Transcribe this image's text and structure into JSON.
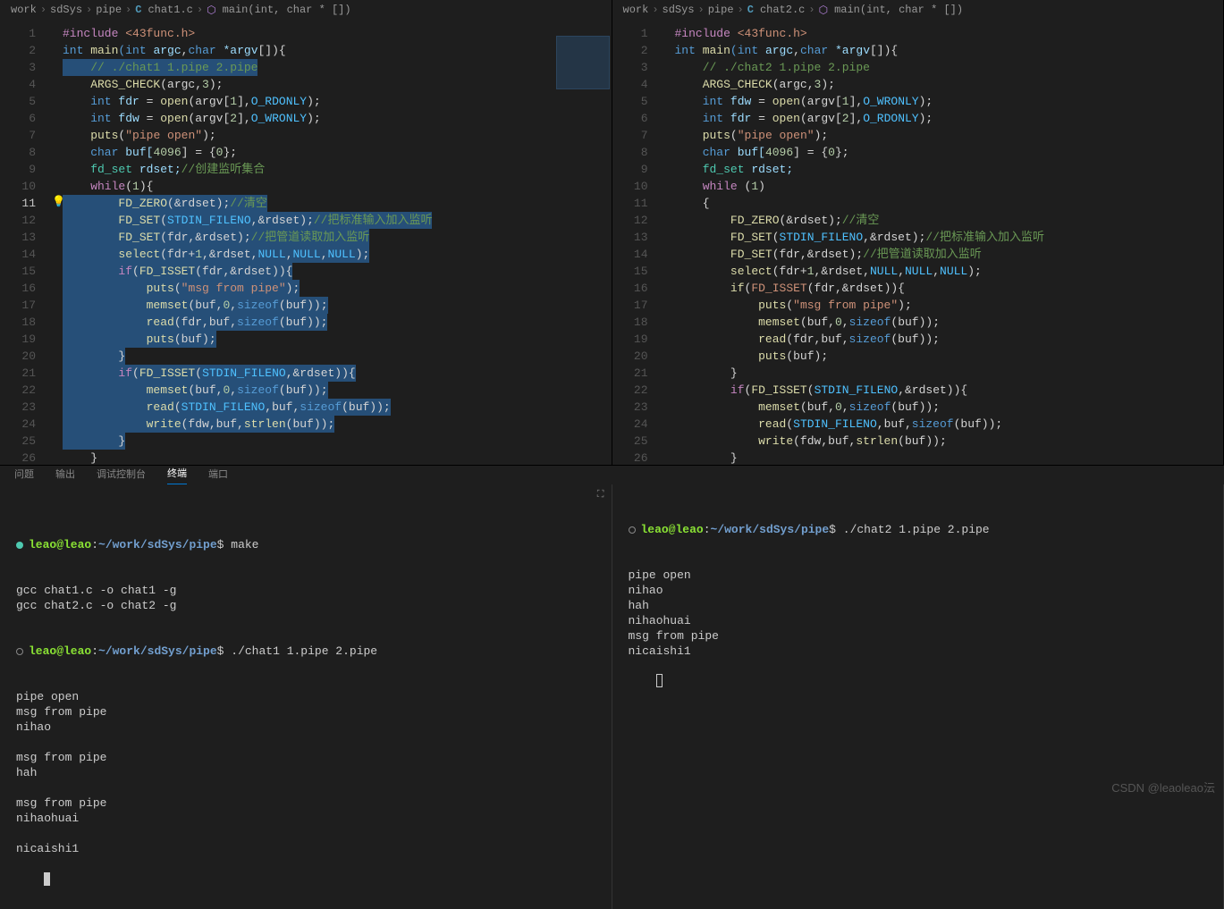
{
  "watermark": "CSDN @leaoleao沄",
  "panelTabs": {
    "problems": "问题",
    "output": "输出",
    "debugConsole": "调试控制台",
    "terminal": "终端",
    "ports": "端口"
  },
  "left": {
    "breadcrumb": {
      "p1": "work",
      "p2": "sdSys",
      "p3": "pipe",
      "file": "chat1.c",
      "fn": "main(int, char * [])"
    },
    "lines": [
      1,
      2,
      3,
      4,
      5,
      6,
      7,
      8,
      9,
      10,
      11,
      12,
      13,
      14,
      15,
      16,
      17,
      18,
      19,
      20,
      21,
      22,
      23,
      24,
      25,
      26
    ],
    "code": {
      "l1": {
        "a": "#include",
        "b": " <43func.h>"
      },
      "l2": {
        "a": "int",
        "b": " main",
        "c": "(int",
        "d": " argc",
        ",": ",",
        "e": "char",
        "f": " *argv",
        "g": "[]){"
      },
      "l3": "    // ./chat1 1.pipe 2.pipe",
      "l4": {
        "a": "    ARGS_CHECK",
        "b": "(argc,",
        "c": "3",
        "d": ");"
      },
      "l5": {
        "a": "    int",
        "b": " fdr ",
        "c": "=",
        "d": " open",
        "e": "(argv[",
        "f": "1",
        "g": "],",
        "h": "O_RDONLY",
        "i": ");"
      },
      "l6": {
        "a": "    int",
        "b": " fdw ",
        "c": "=",
        "d": " open",
        "e": "(argv[",
        "f": "2",
        "g": "],",
        "h": "O_WRONLY",
        "i": ");"
      },
      "l7": {
        "a": "    puts",
        "b": "(",
        "c": "\"pipe open\"",
        "d": ");"
      },
      "l8": {
        "a": "    char",
        "b": " buf[",
        "c": "4096",
        "d": "] = {",
        "e": "0",
        "f": "};"
      },
      "l9": {
        "a": "    fd_set",
        "b": " rdset;",
        "c": "//创建监听集合"
      },
      "l10": {
        "a": "    while",
        "b": "(",
        "c": "1",
        "d": "){"
      },
      "l11": {
        "a": "        FD_ZERO",
        "b": "(&rdset);",
        "c": "//清空"
      },
      "l12": {
        "a": "        FD_SET",
        "b": "(",
        "c": "STDIN_FILENO",
        "d": ",&rdset);",
        "e": "//把标准输入加入监听"
      },
      "l13": {
        "a": "        FD_SET",
        "b": "(fdr,&rdset);",
        "c": "//把管道读取加入监听"
      },
      "l14": {
        "a": "        select",
        "b": "(fdr+",
        "c": "1",
        "d": ",&rdset,",
        "e": "NULL",
        "f": ",",
        "g": "NULL",
        "h": ",",
        "i": "NULL",
        "j": ");"
      },
      "l15": {
        "a": "        if",
        "b": "(",
        "c": "FD_ISSET",
        "d": "(fdr,&rdset)){"
      },
      "l16": {
        "a": "            puts",
        "b": "(",
        "c": "\"msg from pipe\"",
        "d": ");"
      },
      "l17": {
        "a": "            memset",
        "b": "(buf,",
        "c": "0",
        "d": ",",
        "e": "sizeof",
        "f": "(buf));"
      },
      "l18": {
        "a": "            read",
        "b": "(fdr,buf,",
        "c": "sizeof",
        "d": "(buf));"
      },
      "l19": {
        "a": "            puts",
        "b": "(buf);"
      },
      "l20": "        }",
      "l21": {
        "a": "        if",
        "b": "(",
        "c": "FD_ISSET",
        "d": "(",
        "e": "STDIN_FILENO",
        "f": ",&rdset)){"
      },
      "l22": {
        "a": "            memset",
        "b": "(buf,",
        "c": "0",
        "d": ",",
        "e": "sizeof",
        "f": "(buf));"
      },
      "l23": {
        "a": "            read",
        "b": "(",
        "c": "STDIN_FILENO",
        "d": ",buf,",
        "e": "sizeof",
        "f": "(buf));"
      },
      "l24": {
        "a": "            write",
        "b": "(fdw,buf,",
        "c": "strlen",
        "d": "(buf));"
      },
      "l25": "        }",
      "l26": "    }"
    }
  },
  "right": {
    "breadcrumb": {
      "p1": "work",
      "p2": "sdSys",
      "p3": "pipe",
      "file": "chat2.c",
      "fn": "main(int, char * [])"
    },
    "lines": [
      1,
      2,
      3,
      4,
      5,
      6,
      7,
      8,
      9,
      10,
      11,
      12,
      13,
      14,
      15,
      16,
      17,
      18,
      19,
      20,
      21,
      22,
      23,
      24,
      25,
      26
    ],
    "code": {
      "l1": {
        "a": "#include",
        "b": " <43func.h>"
      },
      "l2": {
        "a": "int",
        "b": " main",
        "c": "(int",
        "d": " argc",
        ",": ",",
        "e": "char",
        "f": " *argv",
        "g": "[]){"
      },
      "l3": "    // ./chat2 1.pipe 2.pipe",
      "l4": {
        "a": "    ARGS_CHECK",
        "b": "(argc,",
        "c": "3",
        "d": ");"
      },
      "l5": {
        "a": "    int",
        "b": " fdw ",
        "c": "=",
        "d": " open",
        "e": "(argv[",
        "f": "1",
        "g": "],",
        "h": "O_WRONLY",
        "i": ");"
      },
      "l6": {
        "a": "    int",
        "b": " fdr ",
        "c": "=",
        "d": " open",
        "e": "(argv[",
        "f": "2",
        "g": "],",
        "h": "O_RDONLY",
        "i": ");"
      },
      "l7": {
        "a": "    puts",
        "b": "(",
        "c": "\"pipe open\"",
        "d": ");"
      },
      "l8": {
        "a": "    char",
        "b": " buf[",
        "c": "4096",
        "d": "] = {",
        "e": "0",
        "f": "};"
      },
      "l9": {
        "a": "    fd_set",
        "b": " rdset;"
      },
      "l10": {
        "a": "    while ",
        "b": "(",
        "c": "1",
        "d": ")"
      },
      "l11": "    {",
      "l12": {
        "a": "        FD_ZERO",
        "b": "(&rdset);",
        "c": "//清空"
      },
      "l13": {
        "a": "        FD_SET",
        "b": "(",
        "c": "STDIN_FILENO",
        "d": ",&rdset);",
        "e": "//把标准输入加入监听"
      },
      "l14": {
        "a": "        FD_SET",
        "b": "(fdr,&rdset);",
        "c": "//把管道读取加入监听"
      },
      "l15": {
        "a": "        select",
        "b": "(fdr+",
        "c": "1",
        "d": ",&rdset,",
        "e": "NULL",
        "f": ",",
        "g": "NULL",
        "h": ",",
        "i": "NULL",
        "j": ");"
      },
      "l16": {
        "a": "        if",
        "b": "(",
        "c": "FD_ISSET",
        "d": "(fdr,&rdset)){"
      },
      "l17": {
        "a": "            puts",
        "b": "(",
        "c": "\"msg from pipe\"",
        "d": ");"
      },
      "l18": {
        "a": "            memset",
        "b": "(buf,",
        "c": "0",
        "d": ",",
        "e": "sizeof",
        "f": "(buf));"
      },
      "l19": {
        "a": "            read",
        "b": "(fdr,buf,",
        "c": "sizeof",
        "d": "(buf));"
      },
      "l20": {
        "a": "            puts",
        "b": "(buf);"
      },
      "l21": "        }",
      "l22": {
        "a": "        if",
        "b": "(",
        "c": "FD_ISSET",
        "d": "(",
        "e": "STDIN_FILENO",
        "f": ",&rdset)){"
      },
      "l23": {
        "a": "            memset",
        "b": "(buf,",
        "c": "0",
        "d": ",",
        "e": "sizeof",
        "f": "(buf));"
      },
      "l24": {
        "a": "            read",
        "b": "(",
        "c": "STDIN_FILENO",
        "d": ",buf,",
        "e": "sizeof",
        "f": "(buf));"
      },
      "l25": {
        "a": "            write",
        "b": "(fdw,buf,",
        "c": "strlen",
        "d": "(buf));"
      },
      "l26": "        }"
    }
  },
  "term1": {
    "prompt": {
      "user": "leao@leao",
      "sep": ":",
      "path": "~/work/sdSys/pipe",
      "end": "$"
    },
    "cmd1": "make",
    "out1": "gcc chat1.c -o chat1 -g\ngcc chat2.c -o chat2 -g",
    "cmd2": "./chat1 1.pipe 2.pipe",
    "out2": "pipe open\nmsg from pipe\nnihao\n\nmsg from pipe\nhah\n\nmsg from pipe\nnihaohuai\n\nnicaishi1"
  },
  "term2": {
    "prompt": {
      "user": "leao@leao",
      "sep": ":",
      "path": "~/work/sdSys/pipe",
      "end": "$"
    },
    "cmd1": "./chat2 1.pipe 2.pipe",
    "out1": "pipe open\nnihao\nhah\nnihaohuai\nmsg from pipe\nnicaishi1\n"
  }
}
